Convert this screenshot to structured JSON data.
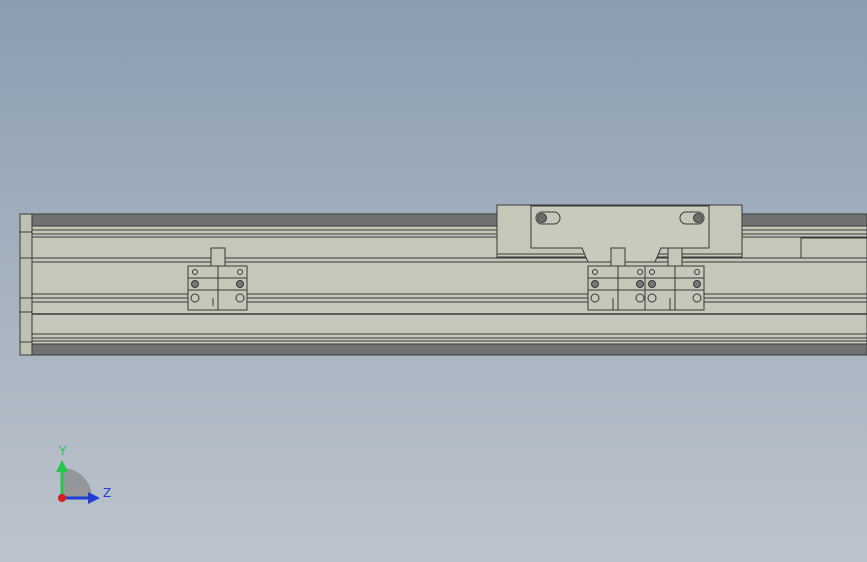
{
  "viewport": {
    "background_top": "#8a9db1",
    "background_bottom": "#bcc3cc",
    "part_color": "#c5c7b8",
    "edge_color": "#3a3a3a",
    "dark_band_color": "#6f7070"
  },
  "model": {
    "parts": [
      "linear-rail-body",
      "carriage-slider",
      "sensor-bracket-left",
      "sensor-bracket-right-a",
      "sensor-bracket-right-b"
    ]
  },
  "triad": {
    "y_label": "Y",
    "z_label": "Z",
    "y_color": "#22c94a",
    "z_color": "#1f3fd6",
    "x_color": "#d81c1c"
  }
}
